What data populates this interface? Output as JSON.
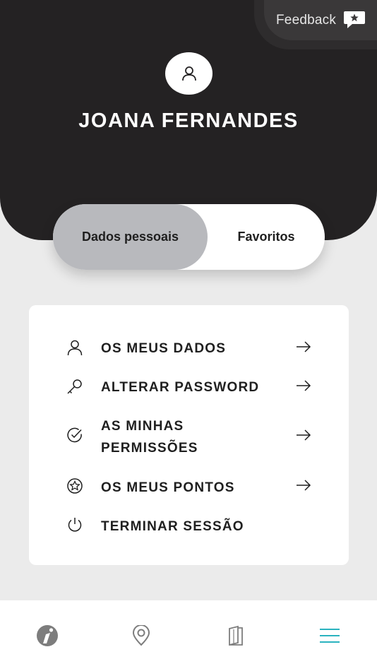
{
  "header": {
    "feedback_label": "Feedback",
    "user_name": "JOANA FERNANDES"
  },
  "tabs": [
    {
      "label": "Dados pessoais",
      "active": true
    },
    {
      "label": "Favoritos",
      "active": false
    }
  ],
  "menu": {
    "items": [
      {
        "label": "OS MEUS DADOS",
        "icon": "user-icon",
        "arrow": true
      },
      {
        "label": "ALTERAR PASSWORD",
        "icon": "key-icon",
        "arrow": true
      },
      {
        "label_line1": "AS MINHAS",
        "label_line2": "PERMISSÕES",
        "icon": "check-circle-icon",
        "arrow": true
      },
      {
        "label": "OS MEUS PONTOS",
        "icon": "star-circle-icon",
        "arrow": true
      },
      {
        "label": "TERMINAR SESSÃO",
        "icon": "power-icon",
        "arrow": false
      }
    ]
  },
  "bottom_nav": {
    "items": [
      {
        "icon": "brand-logo-icon"
      },
      {
        "icon": "map-pin-icon"
      },
      {
        "icon": "book-icon"
      },
      {
        "icon": "menu-icon",
        "active": true
      }
    ]
  },
  "colors": {
    "header_bg": "#242223",
    "tab_active_bg": "#b8b9bd",
    "nav_active": "#2bb3bf",
    "page_bg": "#ebebeb"
  }
}
